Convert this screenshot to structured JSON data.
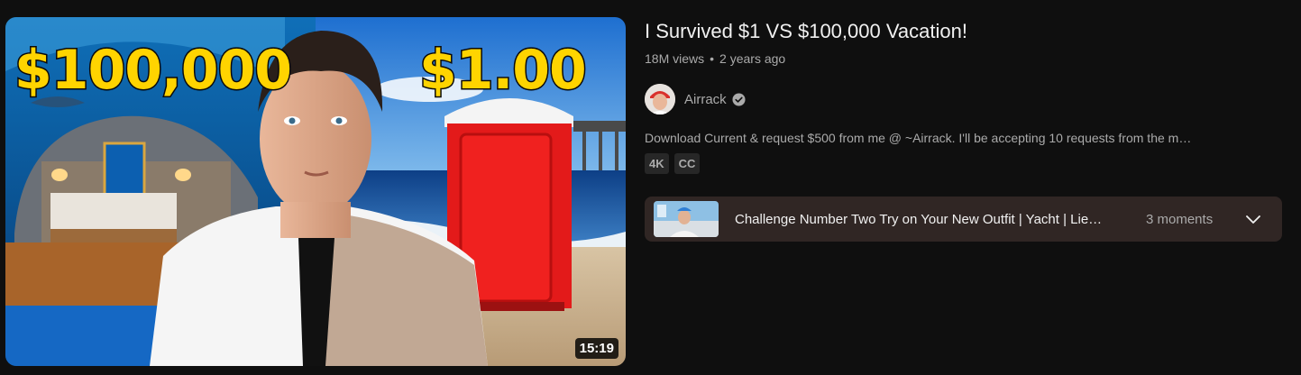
{
  "thumbnail": {
    "price_left": "$100,000",
    "price_right": "$1.00",
    "duration": "15:19"
  },
  "video": {
    "title": "I Survived $1 VS $100,000 Vacation!",
    "views": "18M views",
    "age": "2 years ago"
  },
  "channel": {
    "name": "Airrack",
    "verified_icon": "verified-check-icon"
  },
  "description": "Download Current & request $500 from me @ ~Airrack. I'll be accepting 10 requests from the m…",
  "badges": [
    "4K",
    "CC"
  ],
  "chapters": {
    "title": "Challenge Number Two Try on Your New Outfit | Yacht | Lie…",
    "count": "3 moments",
    "toggle_icon": "chevron-down-icon"
  },
  "colors": {
    "background": "#0f0f0f",
    "chapter_bg": "#302624",
    "price_yellow": "#ffd400"
  }
}
